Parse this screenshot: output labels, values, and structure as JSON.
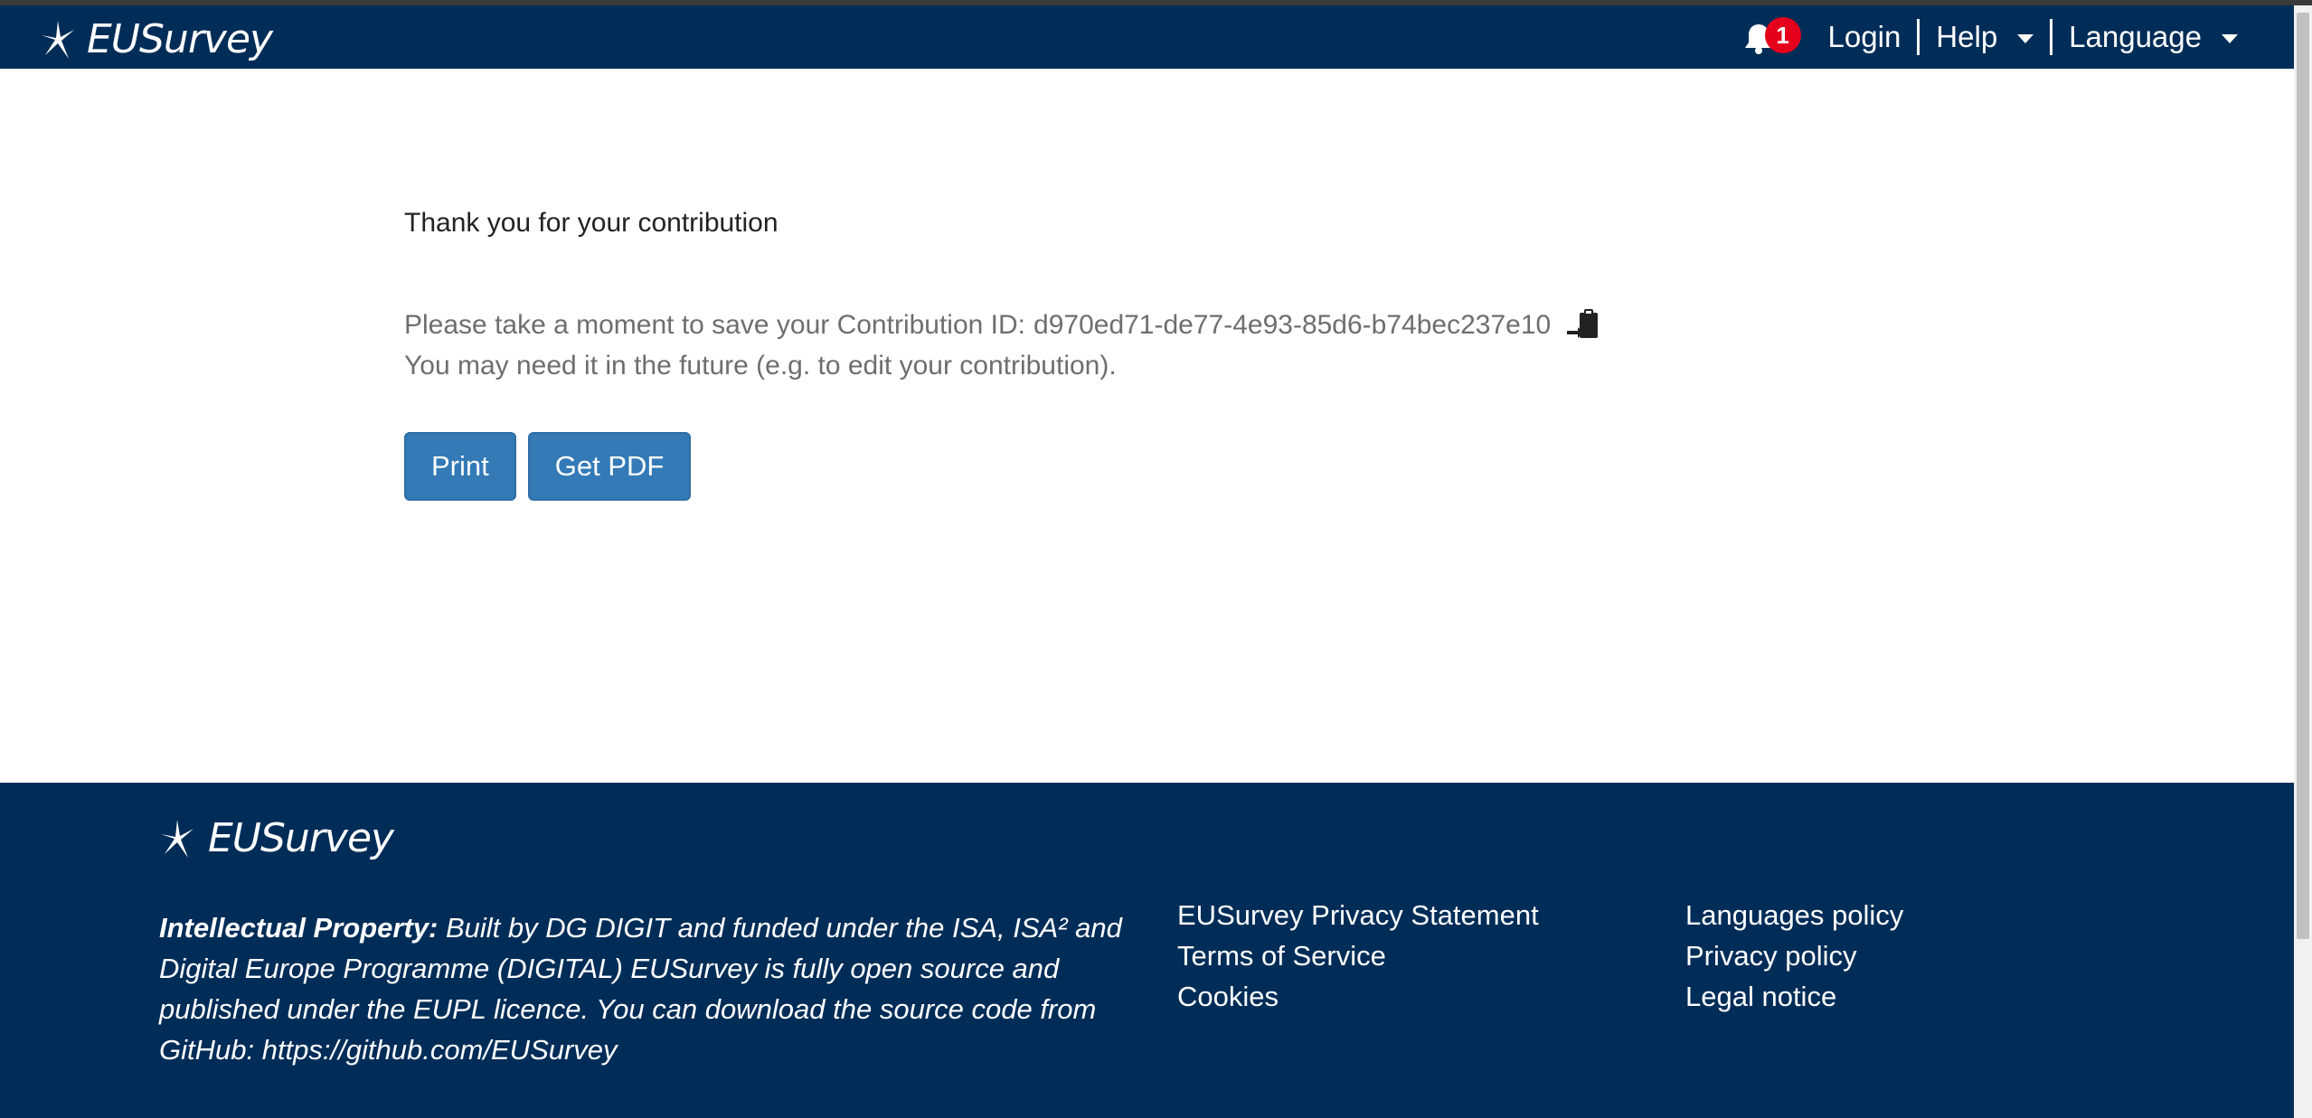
{
  "header": {
    "logo_text": "EUSurvey",
    "notification_count": "1",
    "login": "Login",
    "help": "Help",
    "language": "Language"
  },
  "main": {
    "thanks": "Thank you for your contribution",
    "save_prefix": "Please take a moment to save your Contribution ID:",
    "contribution_id": "d970ed71-de77-4e93-85d6-b74bec237e10",
    "future_msg": "You may need it in the future (e.g. to edit your contribution).",
    "print_label": "Print",
    "pdf_label": "Get PDF"
  },
  "footer": {
    "logo_text": "EUSurvey",
    "ip_label": "Intellectual Property:",
    "ip_text": "Built by DG DIGIT and funded under the ISA, ISA² and Digital Europe Programme (DIGITAL) EUSurvey is fully open source and published under the EUPL licence. You can download the source code from GitHub: https://github.com/EUSurvey",
    "links_col1": [
      "EUSurvey Privacy Statement",
      "Terms of Service",
      "Cookies"
    ],
    "links_col2": [
      "Languages policy",
      "Privacy policy",
      "Legal notice"
    ]
  },
  "colors": {
    "header_bg": "#002d58",
    "button_bg": "#337ab7",
    "badge_bg": "#e4001b"
  },
  "icons": [
    "logo-star-icon",
    "bell-icon",
    "caret-down-icon",
    "copy-clipboard-icon"
  ]
}
